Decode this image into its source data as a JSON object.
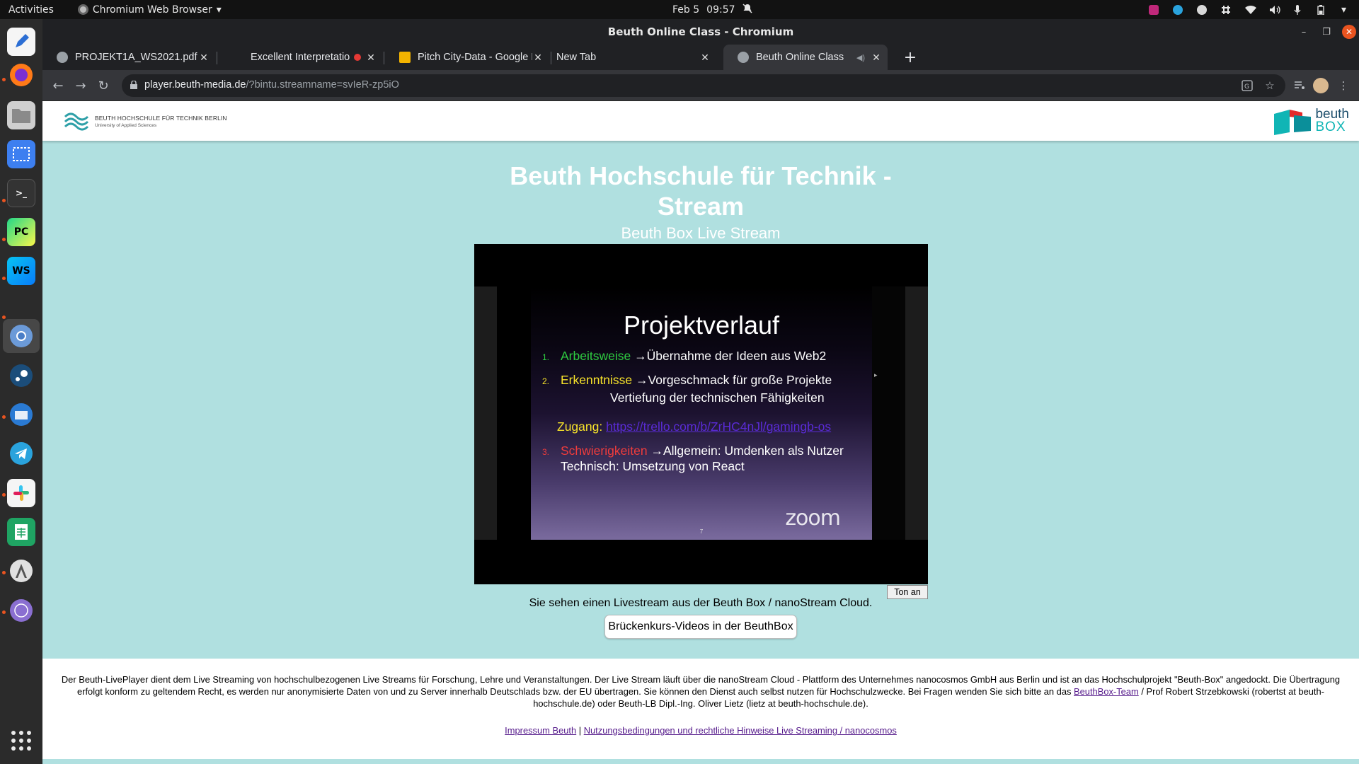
{
  "system": {
    "activities": "Activities",
    "app_name": "Chromium Web Browser",
    "date": "Feb 5",
    "time": "09:57"
  },
  "dock": {
    "items": [
      "text-editor",
      "firefox",
      "files",
      "screenshot",
      "terminal",
      "pycharm",
      "webstorm",
      "chromium",
      "steam",
      "thunderbird",
      "telegram",
      "slack",
      "spreadsheet",
      "software-updater",
      "tor"
    ],
    "pycharm_label": "PC",
    "webstorm_label": "WS"
  },
  "window": {
    "title": "Beuth Online Class - Chromium"
  },
  "tabs": [
    {
      "label": "PROJEKT1A_WS2021.pdf"
    },
    {
      "label": "Excellent Interpretatio"
    },
    {
      "label": "Pitch City-Data - Google P"
    },
    {
      "label": "New Tab"
    },
    {
      "label": "Beuth Online Class"
    }
  ],
  "toolbar": {
    "url_host": "player.beuth-media.de",
    "url_path": "/?bintu.streamname=svIeR-zp5iO"
  },
  "header": {
    "bht_line1": "BEUTH HOCHSCHULE FÜR TECHNIK BERLIN",
    "bht_line2": "University of Applied Sciences",
    "box_line1": "beuth",
    "box_line2": "BOX"
  },
  "main": {
    "title": "Beuth Hochschule für Technik - Stream",
    "subtitle": "Beuth Box Live Stream"
  },
  "slide": {
    "title": "Projektverlauf",
    "item1_num": "1.",
    "item1_key": "Arbeitsweise",
    "item1_text": "→Übernahme der Ideen aus Web2",
    "item2_num": "2.",
    "item2_key": "Erkenntnisse",
    "item2_text": "→Vorgeschmack für große Projekte",
    "item2_text2": "Vertiefung der technischen Fähigkeiten",
    "access_label": "Zugang:",
    "access_link": "https://trello.com/b/ZrHC4nJl/gamingb-os",
    "item3_num": "3.",
    "item3_key": "Schwierigkeiten",
    "item3_text": "→Allgemein: Umdenken als Nutzer",
    "item3_text2": "Technisch: Umsetzung von React",
    "watermark": "zoom",
    "page_number": "7"
  },
  "player": {
    "sound_button": "Ton an",
    "note": "Sie sehen einen Livestream aus der Beuth Box / nanoStream Cloud.",
    "course_button": "Brückenkurs-Videos in der BeuthBox"
  },
  "footer": {
    "text_a": "Der Beuth-LivePlayer dient dem Live Streaming von hochschulbezogenen Live Streams für Forschung, Lehre und Veranstaltungen. Der Live Stream läuft über die nanoStream Cloud - Plattform des Unternehmes nanocosmos GmbH aus Berlin und ist an das Hochschulprojekt \"Beuth-Box\" angedockt. Die Übertragung erfolgt konform zu geltendem Recht, es werden nur anonymisierte Daten von und zu Server innerhalb Deutschlads bzw. der EU übertragen. Sie können den Dienst auch selbst nutzen für Hochschulzwecke. Bei Fragen wenden Sie sich bitte an das ",
    "team_link": "BeuthBox-Team",
    "text_b": " / Prof Robert Strzebkowski (robertst at beuth-hochschule.de) oder Beuth-LB Dipl.-Ing. Oliver Lietz (lietz at beuth-hochschule.de).",
    "impressum": "Impressum Beuth",
    "separator": " | ",
    "terms": "Nutzungsbedingungen und rechtliche Hinweise Live Streaming / nanocosmos"
  }
}
